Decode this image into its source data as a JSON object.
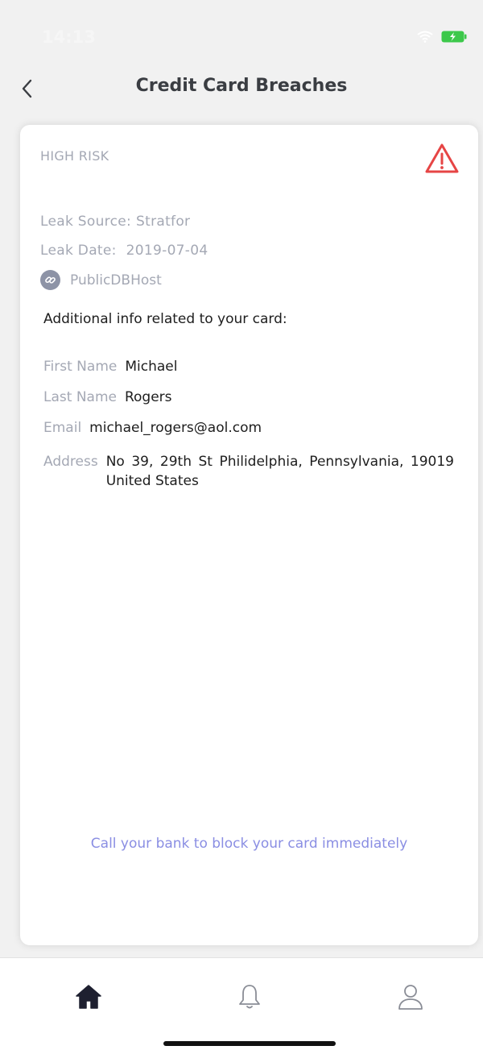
{
  "status_bar": {
    "time": "14:13"
  },
  "header": {
    "title": "Credit Card Breaches"
  },
  "card": {
    "risk_level": "HIGH RISK",
    "leak_source_label": "Leak Source:",
    "leak_source_value": "Stratfor",
    "leak_date_label": "Leak Date:",
    "leak_date_value": "2019-07-04",
    "source_link": "PublicDBHost",
    "info_heading": "Additional info related to your card:",
    "fields": [
      {
        "label": "First Name",
        "value": "Michael"
      },
      {
        "label": "Last Name",
        "value": "Rogers"
      },
      {
        "label": "Email",
        "value": "michael_rogers@aol.com"
      },
      {
        "label": "Address",
        "value": "No 39, 29th St Philidelphia, Pennsylvania, 19019 United States"
      }
    ],
    "cta": "Call your bank to block your card immediately"
  },
  "tabs": [
    {
      "icon": "home-icon",
      "active": true
    },
    {
      "icon": "bell-icon",
      "active": false
    },
    {
      "icon": "user-icon",
      "active": false
    }
  ],
  "colors": {
    "warning": "#e64545",
    "accent_link": "#8a8ee3",
    "muted_text": "#a4a8b4",
    "battery": "#3cc84a"
  }
}
